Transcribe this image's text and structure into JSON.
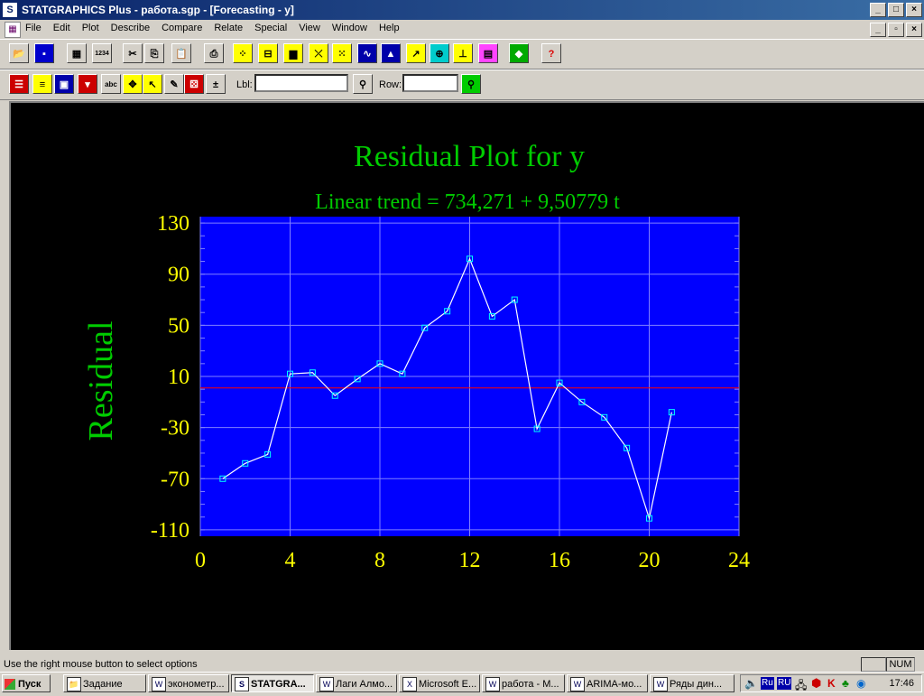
{
  "window": {
    "title": "STATGRAPHICS Plus - работа.sgp - [Forecasting - y]",
    "controls": [
      "_",
      "□",
      "×"
    ]
  },
  "menu": {
    "items": [
      "File",
      "Edit",
      "Plot",
      "Describe",
      "Compare",
      "Relate",
      "Special",
      "View",
      "Window",
      "Help"
    ],
    "mdi_controls": [
      "_",
      "▫",
      "×"
    ]
  },
  "toolbar1": {
    "buttons": [
      {
        "name": "open-icon",
        "glyph": "📂",
        "bg": "#d4d0c8"
      },
      {
        "name": "save-icon",
        "glyph": "▪",
        "bg": "#0000cc"
      },
      {
        "name": "spreadsheet-icon",
        "glyph": "▦",
        "bg": "#d4d0c8"
      },
      {
        "name": "data-save-icon",
        "glyph": "1234",
        "bg": "#d4d0c8"
      },
      {
        "name": "cut-icon",
        "glyph": "✂",
        "bg": "#d4d0c8"
      },
      {
        "name": "copy-icon",
        "glyph": "⎘",
        "bg": "#d4d0c8"
      },
      {
        "name": "paste-icon",
        "glyph": "📋",
        "bg": "#d4d0c8"
      },
      {
        "name": "print-icon",
        "glyph": "⎙",
        "bg": "#d4d0c8"
      },
      {
        "name": "scatter-icon",
        "glyph": "⁘",
        "bg": "#ffff00"
      },
      {
        "name": "boxplot-icon",
        "glyph": "⊟",
        "bg": "#ffff00"
      },
      {
        "name": "histogram-icon",
        "glyph": "▆",
        "bg": "#ffff00"
      },
      {
        "name": "xy-icon",
        "glyph": "⤫",
        "bg": "#ffff00"
      },
      {
        "name": "matrix-icon",
        "glyph": "⁙",
        "bg": "#ffff00"
      },
      {
        "name": "timeseries-icon",
        "glyph": "∿",
        "bg": "#0000aa"
      },
      {
        "name": "distribution-icon",
        "glyph": "▲",
        "bg": "#0000aa"
      },
      {
        "name": "trend-icon",
        "glyph": "↗",
        "bg": "#ffff00"
      },
      {
        "name": "globe-icon",
        "glyph": "⊕",
        "bg": "#00cccc"
      },
      {
        "name": "tree-icon",
        "glyph": "⊥",
        "bg": "#ffff00"
      },
      {
        "name": "qc-icon",
        "glyph": "▤",
        "bg": "#ff44ff"
      },
      {
        "name": "statadvisor-icon",
        "glyph": "◆",
        "bg": "#00aa00"
      },
      {
        "name": "help-icon",
        "glyph": "?",
        "bg": "#d4d0c8"
      }
    ]
  },
  "toolbar2": {
    "buttons": [
      {
        "name": "input-dialog-icon",
        "glyph": "☰",
        "bg": "#cc0000"
      },
      {
        "name": "tables-icon",
        "glyph": "≡",
        "bg": "#ffff00"
      },
      {
        "name": "graphs-icon",
        "glyph": "▣",
        "bg": "#0000aa"
      },
      {
        "name": "save-results-icon",
        "glyph": "▾",
        "bg": "#cc0000"
      },
      {
        "name": "analysis-options-icon",
        "glyph": "abc",
        "bg": "#d4d0c8"
      },
      {
        "name": "pane-options-icon",
        "glyph": "✥",
        "bg": "#ffff00"
      },
      {
        "name": "exclude-icon",
        "glyph": "↖",
        "bg": "#ffff00"
      },
      {
        "name": "brush-icon",
        "glyph": "✎",
        "bg": "#d4d0c8"
      },
      {
        "name": "dice-icon",
        "glyph": "⚄",
        "bg": "#cc0000"
      },
      {
        "name": "plusminus-icon",
        "glyph": "±",
        "bg": "#d4d0c8"
      }
    ],
    "lbl_label": "Lbl:",
    "lbl_value": "",
    "row_label": "Row:",
    "row_value": "",
    "find_lbl_icon": "binoculars-icon",
    "find_row_icon": "binoculars-icon"
  },
  "chart_data": {
    "type": "line",
    "title": "Residual Plot for y",
    "subtitle": "Linear trend = 734,271 + 9,50779 t",
    "xlabel": "",
    "ylabel": "Residual",
    "xlim": [
      0,
      24
    ],
    "ylim": [
      -115,
      135
    ],
    "xticks": [
      0,
      4,
      8,
      12,
      16,
      20,
      24
    ],
    "yticks": [
      130,
      90,
      50,
      10,
      -30,
      -70,
      -110
    ],
    "x": [
      1,
      2,
      3,
      4,
      5,
      6,
      7,
      8,
      9,
      10,
      11,
      12,
      13,
      14,
      15,
      16,
      17,
      18,
      19,
      20,
      21
    ],
    "values": [
      -70,
      -58,
      -51,
      12,
      13,
      -5,
      8,
      20,
      12,
      48,
      61,
      102,
      57,
      70,
      -31,
      5,
      -10,
      -22,
      -46,
      -101,
      -18
    ],
    "reference_line": 1,
    "grid": true,
    "colors": {
      "background": "#000000",
      "plot_area": "#0000ff",
      "title": "#00cc00",
      "tick_labels": "#ffff00",
      "series": "#ffffff",
      "markers": "#00ffff",
      "reference": "#ff0000",
      "grid": "#8080ff"
    }
  },
  "status": {
    "text": "Use the right mouse button to select options",
    "num": "NUM"
  },
  "taskbar": {
    "start": "Пуск",
    "tasks": [
      {
        "label": "Задание",
        "icon": "📁"
      },
      {
        "label": "эконометр...",
        "icon": "W"
      },
      {
        "label": "STATGRA...",
        "icon": "S",
        "active": true
      },
      {
        "label": "Лаги Алмо...",
        "icon": "W"
      },
      {
        "label": "Microsoft E...",
        "icon": "X"
      },
      {
        "label": "работа - M...",
        "icon": "W"
      },
      {
        "label": "ARIMA-мо...",
        "icon": "W"
      },
      {
        "label": "Ряды дин...",
        "icon": "W"
      }
    ],
    "tray_langs": [
      "Ru",
      "RU"
    ],
    "clock": "17:46"
  }
}
